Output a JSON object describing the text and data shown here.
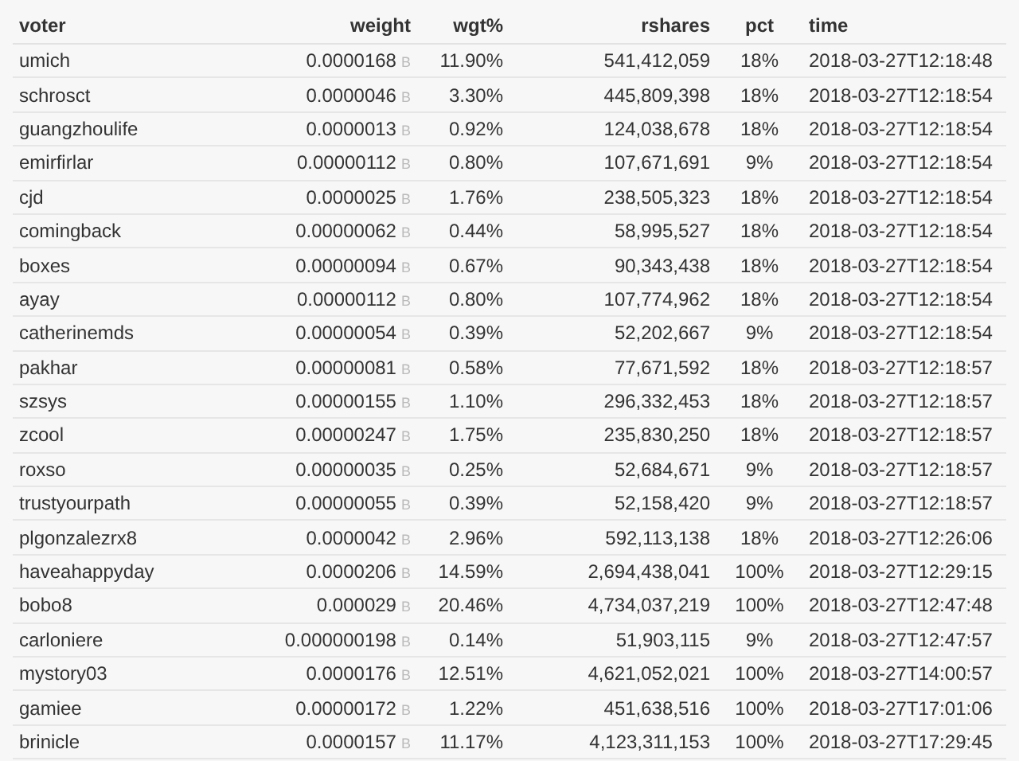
{
  "table": {
    "columns": [
      {
        "label": "voter"
      },
      {
        "label": "weight"
      },
      {
        "label": "wgt%"
      },
      {
        "label": "rshares"
      },
      {
        "label": "pct"
      },
      {
        "label": "time"
      }
    ],
    "rows": [
      {
        "voter": "umich",
        "weight": "0.0000168",
        "unit": "B",
        "wgt": "11.90%",
        "rshares": "541,412,059",
        "pct": "18%",
        "time": "2018-03-27T12:18:48"
      },
      {
        "voter": "schrosct",
        "weight": "0.0000046",
        "unit": "B",
        "wgt": "3.30%",
        "rshares": "445,809,398",
        "pct": "18%",
        "time": "2018-03-27T12:18:54"
      },
      {
        "voter": "guangzhoulife",
        "weight": "0.0000013",
        "unit": "B",
        "wgt": "0.92%",
        "rshares": "124,038,678",
        "pct": "18%",
        "time": "2018-03-27T12:18:54"
      },
      {
        "voter": "emirfirlar",
        "weight": "0.00000112",
        "unit": "B",
        "wgt": "0.80%",
        "rshares": "107,671,691",
        "pct": "9%",
        "time": "2018-03-27T12:18:54"
      },
      {
        "voter": "cjd",
        "weight": "0.0000025",
        "unit": "B",
        "wgt": "1.76%",
        "rshares": "238,505,323",
        "pct": "18%",
        "time": "2018-03-27T12:18:54"
      },
      {
        "voter": "comingback",
        "weight": "0.00000062",
        "unit": "B",
        "wgt": "0.44%",
        "rshares": "58,995,527",
        "pct": "18%",
        "time": "2018-03-27T12:18:54"
      },
      {
        "voter": "boxes",
        "weight": "0.00000094",
        "unit": "B",
        "wgt": "0.67%",
        "rshares": "90,343,438",
        "pct": "18%",
        "time": "2018-03-27T12:18:54"
      },
      {
        "voter": "ayay",
        "weight": "0.00000112",
        "unit": "B",
        "wgt": "0.80%",
        "rshares": "107,774,962",
        "pct": "18%",
        "time": "2018-03-27T12:18:54"
      },
      {
        "voter": "catherinemds",
        "weight": "0.00000054",
        "unit": "B",
        "wgt": "0.39%",
        "rshares": "52,202,667",
        "pct": "9%",
        "time": "2018-03-27T12:18:54"
      },
      {
        "voter": "pakhar",
        "weight": "0.00000081",
        "unit": "B",
        "wgt": "0.58%",
        "rshares": "77,671,592",
        "pct": "18%",
        "time": "2018-03-27T12:18:57"
      },
      {
        "voter": "szsys",
        "weight": "0.00000155",
        "unit": "B",
        "wgt": "1.10%",
        "rshares": "296,332,453",
        "pct": "18%",
        "time": "2018-03-27T12:18:57"
      },
      {
        "voter": "zcool",
        "weight": "0.00000247",
        "unit": "B",
        "wgt": "1.75%",
        "rshares": "235,830,250",
        "pct": "18%",
        "time": "2018-03-27T12:18:57"
      },
      {
        "voter": "roxso",
        "weight": "0.00000035",
        "unit": "B",
        "wgt": "0.25%",
        "rshares": "52,684,671",
        "pct": "9%",
        "time": "2018-03-27T12:18:57"
      },
      {
        "voter": "trustyourpath",
        "weight": "0.00000055",
        "unit": "B",
        "wgt": "0.39%",
        "rshares": "52,158,420",
        "pct": "9%",
        "time": "2018-03-27T12:18:57"
      },
      {
        "voter": "plgonzalezrx8",
        "weight": "0.0000042",
        "unit": "B",
        "wgt": "2.96%",
        "rshares": "592,113,138",
        "pct": "18%",
        "time": "2018-03-27T12:26:06"
      },
      {
        "voter": "haveahappyday",
        "weight": "0.0000206",
        "unit": "B",
        "wgt": "14.59%",
        "rshares": "2,694,438,041",
        "pct": "100%",
        "time": "2018-03-27T12:29:15"
      },
      {
        "voter": "bobo8",
        "weight": "0.000029",
        "unit": "B",
        "wgt": "20.46%",
        "rshares": "4,734,037,219",
        "pct": "100%",
        "time": "2018-03-27T12:47:48"
      },
      {
        "voter": "carloniere",
        "weight": "0.000000198",
        "unit": "B",
        "wgt": "0.14%",
        "rshares": "51,903,115",
        "pct": "9%",
        "time": "2018-03-27T12:47:57"
      },
      {
        "voter": "mystory03",
        "weight": "0.0000176",
        "unit": "B",
        "wgt": "12.51%",
        "rshares": "4,621,052,021",
        "pct": "100%",
        "time": "2018-03-27T14:00:57"
      },
      {
        "voter": "gamiee",
        "weight": "0.00000172",
        "unit": "B",
        "wgt": "1.22%",
        "rshares": "451,638,516",
        "pct": "100%",
        "time": "2018-03-27T17:01:06"
      },
      {
        "voter": "brinicle",
        "weight": "0.0000157",
        "unit": "B",
        "wgt": "11.17%",
        "rshares": "4,123,311,153",
        "pct": "100%",
        "time": "2018-03-27T17:29:45"
      }
    ]
  }
}
